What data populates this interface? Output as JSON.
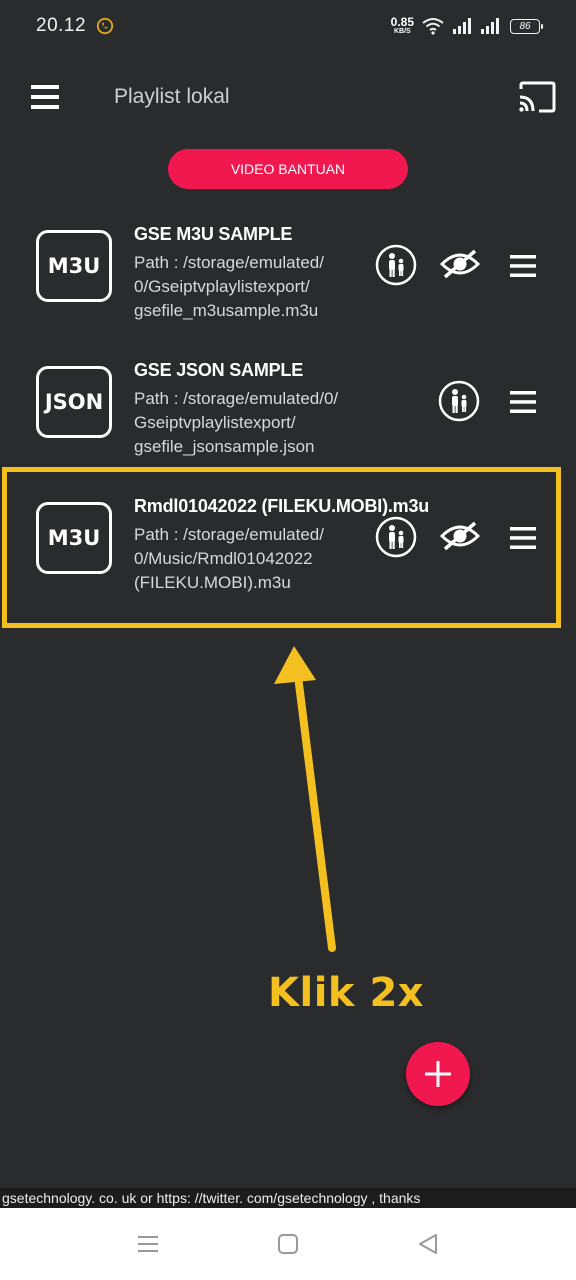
{
  "status_bar": {
    "time": "20.12",
    "net_speed_value": "0.85",
    "net_speed_unit": "KB/S",
    "battery": "86",
    "notification_icon": "whatsapp-icon"
  },
  "app_bar": {
    "title": "Playlist lokal",
    "menu_icon": "hamburger-menu-icon",
    "cast_icon": "cast-icon"
  },
  "video_button_label": "VIDEO BANTUAN",
  "playlists": [
    {
      "badge": "M3U",
      "title": "GSE M3U SAMPLE",
      "path_lines": [
        "Path : /storage/emulated/",
        "0/Gseiptvplaylistexport/",
        "gsefile_m3usample.m3u"
      ],
      "icons": [
        "parental-control-icon",
        "visibility-off-icon",
        "drag-handle-icon"
      ]
    },
    {
      "badge": "JSON",
      "title": "GSE JSON SAMPLE",
      "path_lines": [
        "Path : /storage/emulated/0/",
        "Gseiptvplaylistexport/",
        "gsefile_jsonsample.json"
      ],
      "icons": [
        "parental-control-icon",
        "drag-handle-icon"
      ]
    },
    {
      "badge": "M3U",
      "title": "Rmdl01042022 (FILEKU.MOBI).m3u",
      "path_lines": [
        "Path : /storage/emulated/",
        "0/Music/Rmdl01042022",
        "(FILEKU.MOBI).m3u"
      ],
      "icons": [
        "parental-control-icon",
        "visibility-off-icon",
        "drag-handle-icon"
      ]
    }
  ],
  "annotation": {
    "text": "Klik 2x",
    "color": "#f4c020"
  },
  "fab_icon": "plus-icon",
  "marquee_text": "gsetechnology. co. uk or https: //twitter. com/gsetechnology ,  thanks",
  "nav_bar": {
    "icons": [
      "recents-icon",
      "home-icon",
      "back-icon"
    ]
  },
  "colors": {
    "background": "#2a2b2d",
    "accent": "#f1184f",
    "highlight": "#f4c020"
  }
}
